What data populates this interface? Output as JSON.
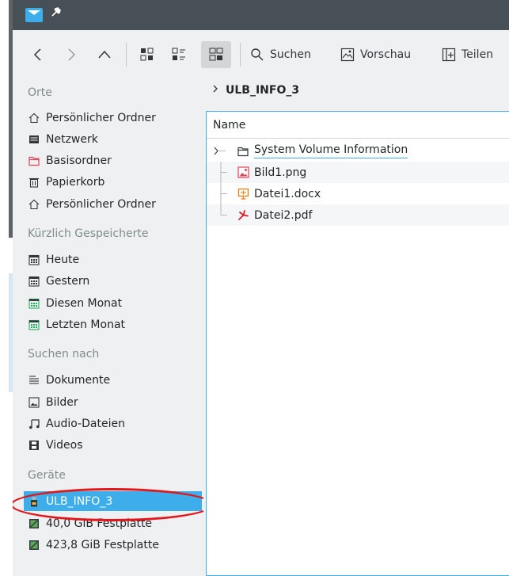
{
  "titlebar": {
    "pin_symbol": "✕"
  },
  "toolbar": {
    "search_label": "Suchen",
    "preview_label": "Vorschau",
    "split_label": "Teilen"
  },
  "sidebar": {
    "places_heading": "Orte",
    "places": [
      {
        "label": "Persönlicher Ordner",
        "icon": "home-icon"
      },
      {
        "label": "Netzwerk",
        "icon": "network-icon"
      },
      {
        "label": "Basisordner",
        "icon": "folder-red-icon"
      },
      {
        "label": "Papierkorb",
        "icon": "trash-icon"
      },
      {
        "label": "Persönlicher Ordner",
        "icon": "home-icon"
      }
    ],
    "recent_heading": "Kürzlich Gespeicherte",
    "recent": [
      {
        "label": "Heute"
      },
      {
        "label": "Gestern"
      },
      {
        "label": "Diesen Monat"
      },
      {
        "label": "Letzten Monat"
      }
    ],
    "search_heading": "Suchen nach",
    "search": [
      {
        "label": "Dokumente"
      },
      {
        "label": "Bilder"
      },
      {
        "label": "Audio-Dateien"
      },
      {
        "label": "Videos"
      }
    ],
    "devices_heading": "Geräte",
    "devices": [
      {
        "label": "ULB_INFO_3",
        "selected": true
      },
      {
        "label": "40,0 GiB Festplatte"
      },
      {
        "label": "423,8 GiB Festplatte"
      }
    ]
  },
  "content": {
    "breadcrumb": "ULB_INFO_3",
    "column_name": "Name",
    "files": [
      {
        "name": "System Volume Information",
        "type": "folder"
      },
      {
        "name": "Bild1.png",
        "type": "image"
      },
      {
        "name": "Datei1.docx",
        "type": "document"
      },
      {
        "name": "Datei2.pdf",
        "type": "pdf"
      }
    ]
  },
  "colors": {
    "accent": "#3daee9",
    "titlebar": "#475057",
    "annotation": "#e3171b"
  }
}
